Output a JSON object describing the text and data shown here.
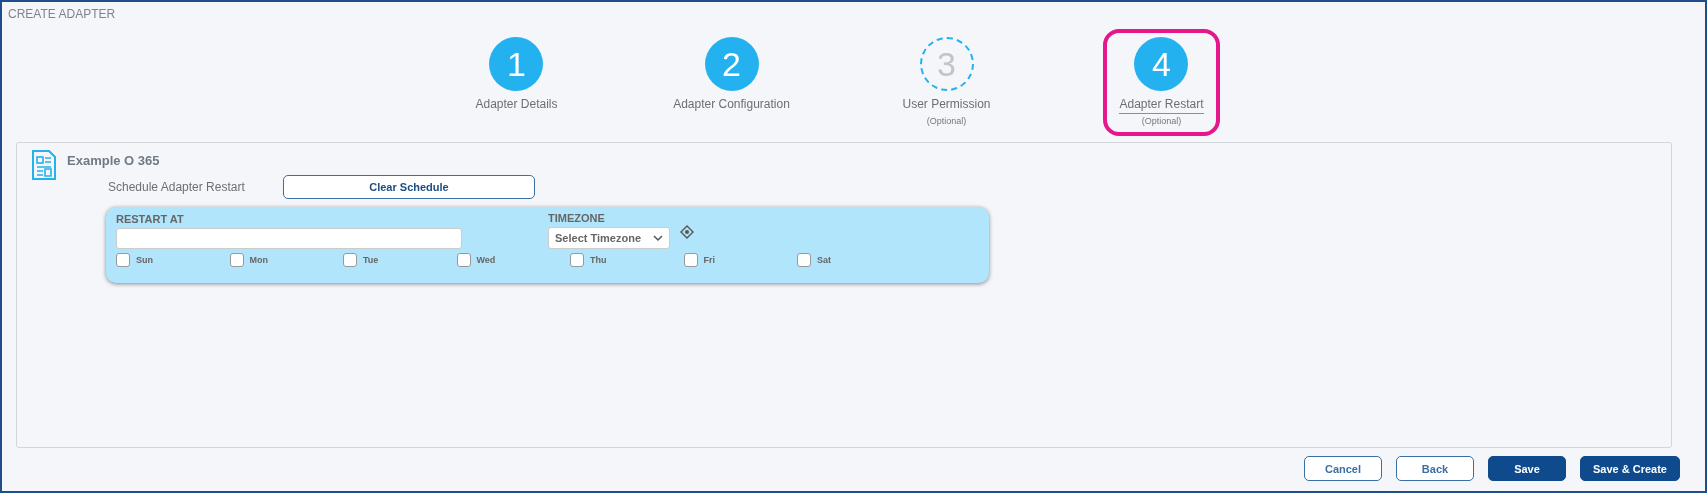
{
  "page_title": "CREATE ADAPTER",
  "steps": [
    {
      "number": "1",
      "label": "Adapter Details",
      "completed": true,
      "selected": false
    },
    {
      "number": "2",
      "label": "Adapter Configuration",
      "completed": true,
      "selected": false
    },
    {
      "number": "3",
      "label": "User Permission",
      "note": "(Optional)",
      "completed": false,
      "selected": false
    },
    {
      "number": "4",
      "label": "Adapter Restart",
      "note": "(Optional)",
      "completed": true,
      "selected": true
    }
  ],
  "panel": {
    "title": "Example O 365",
    "schedule_label": "Schedule Adapter Restart",
    "clear_button": "Clear Schedule",
    "restart_at": {
      "label": "RESTART AT"
    },
    "timezone": {
      "label": "TIMEZONE",
      "value": "Select Timezone"
    },
    "days": [
      {
        "label": "Sun",
        "checked": false
      },
      {
        "label": "Mon",
        "checked": false
      },
      {
        "label": "Tue",
        "checked": false
      },
      {
        "label": "Wed",
        "checked": false
      },
      {
        "label": "Thu",
        "checked": false
      },
      {
        "label": "Fri",
        "checked": false
      },
      {
        "label": "Sat",
        "checked": false
      }
    ]
  },
  "buttons": [
    {
      "label": "Cancel",
      "kind": "outline"
    },
    {
      "label": "Back",
      "kind": "outline"
    },
    {
      "label": "Save",
      "kind": "primary"
    },
    {
      "label": "Save & Create",
      "kind": "primary"
    }
  ]
}
